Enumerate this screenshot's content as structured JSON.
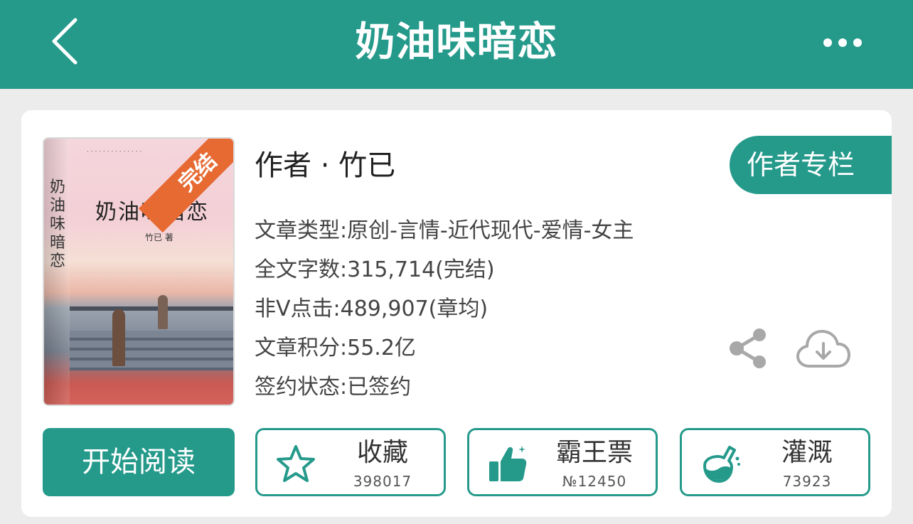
{
  "header": {
    "title": "奶油味暗恋"
  },
  "cover": {
    "title": "奶油味暗恋",
    "author": "竹已 著",
    "badge": "完结"
  },
  "info": {
    "author": "作者 · 竹已",
    "type": "文章类型:原创-言情-近代现代-爱情-女主",
    "words": "全文字数:315,714(完结)",
    "clicks": "非Ⅴ点击:489,907(章均)",
    "score": "文章积分:55.2亿",
    "sign": "签约状态:已签约"
  },
  "buttons": {
    "author_column": "作者专栏",
    "start_reading": "开始阅读"
  },
  "actions": [
    {
      "label": "收藏",
      "count": "398017"
    },
    {
      "label": "霸王票",
      "count": "№12450"
    },
    {
      "label": "灌溉",
      "count": "73923"
    }
  ],
  "colors": {
    "accent": "#259a8b",
    "badge": "#e66a32"
  }
}
